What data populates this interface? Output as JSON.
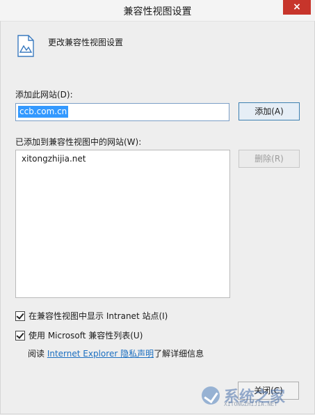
{
  "window": {
    "title": "兼容性视图设置",
    "close_glyph": "×"
  },
  "header": {
    "icon": "document-compat-icon",
    "text": "更改兼容性视图设置"
  },
  "add_site": {
    "label": "添加此网站(D):",
    "value": "ccb.com.cn",
    "button": "添加(A)"
  },
  "site_list": {
    "label": "已添加到兼容性视图中的网站(W):",
    "items": [
      "xitongzhijia.net"
    ],
    "remove_button": "删除(R)"
  },
  "options": {
    "intranet": {
      "label": "在兼容性视图中显示 Intranet 站点(I)",
      "checked": true
    },
    "ms_list": {
      "label": "使用 Microsoft 兼容性列表(U)",
      "checked": true
    }
  },
  "privacy": {
    "prefix": "阅读 ",
    "link": "Internet Explorer 隐私声明",
    "suffix": "了解详细信息"
  },
  "footer": {
    "close_button": "关闭(C)"
  },
  "watermark": {
    "text": "系统之家",
    "sub": "XITONGZHIJIA.NET"
  },
  "colors": {
    "close_red": "#c7352b",
    "link_blue": "#1a6ec0",
    "selection": "#3399ff"
  }
}
